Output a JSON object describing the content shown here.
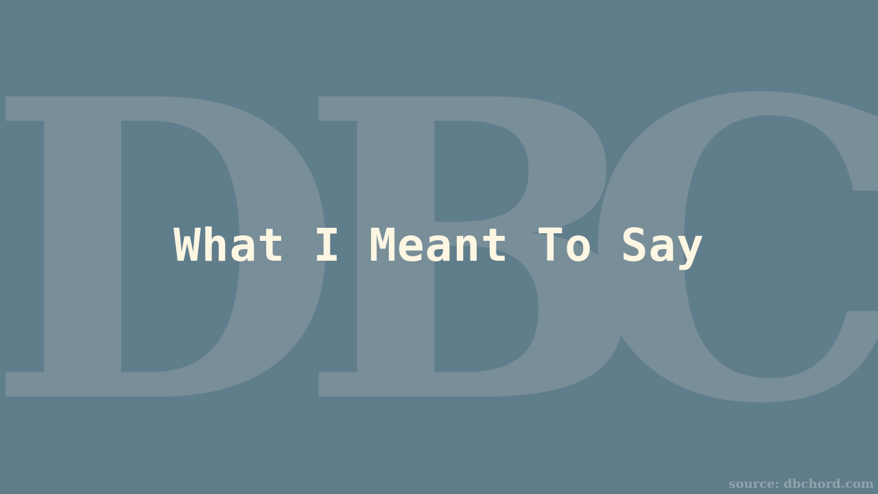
{
  "watermark": {
    "letters": [
      "D",
      "B",
      "C"
    ],
    "color": "#788e99"
  },
  "background_color": "#607d8b",
  "title": "What I Meant To Say",
  "title_color": "#fdf6e3",
  "source": "source: dbchord.com"
}
